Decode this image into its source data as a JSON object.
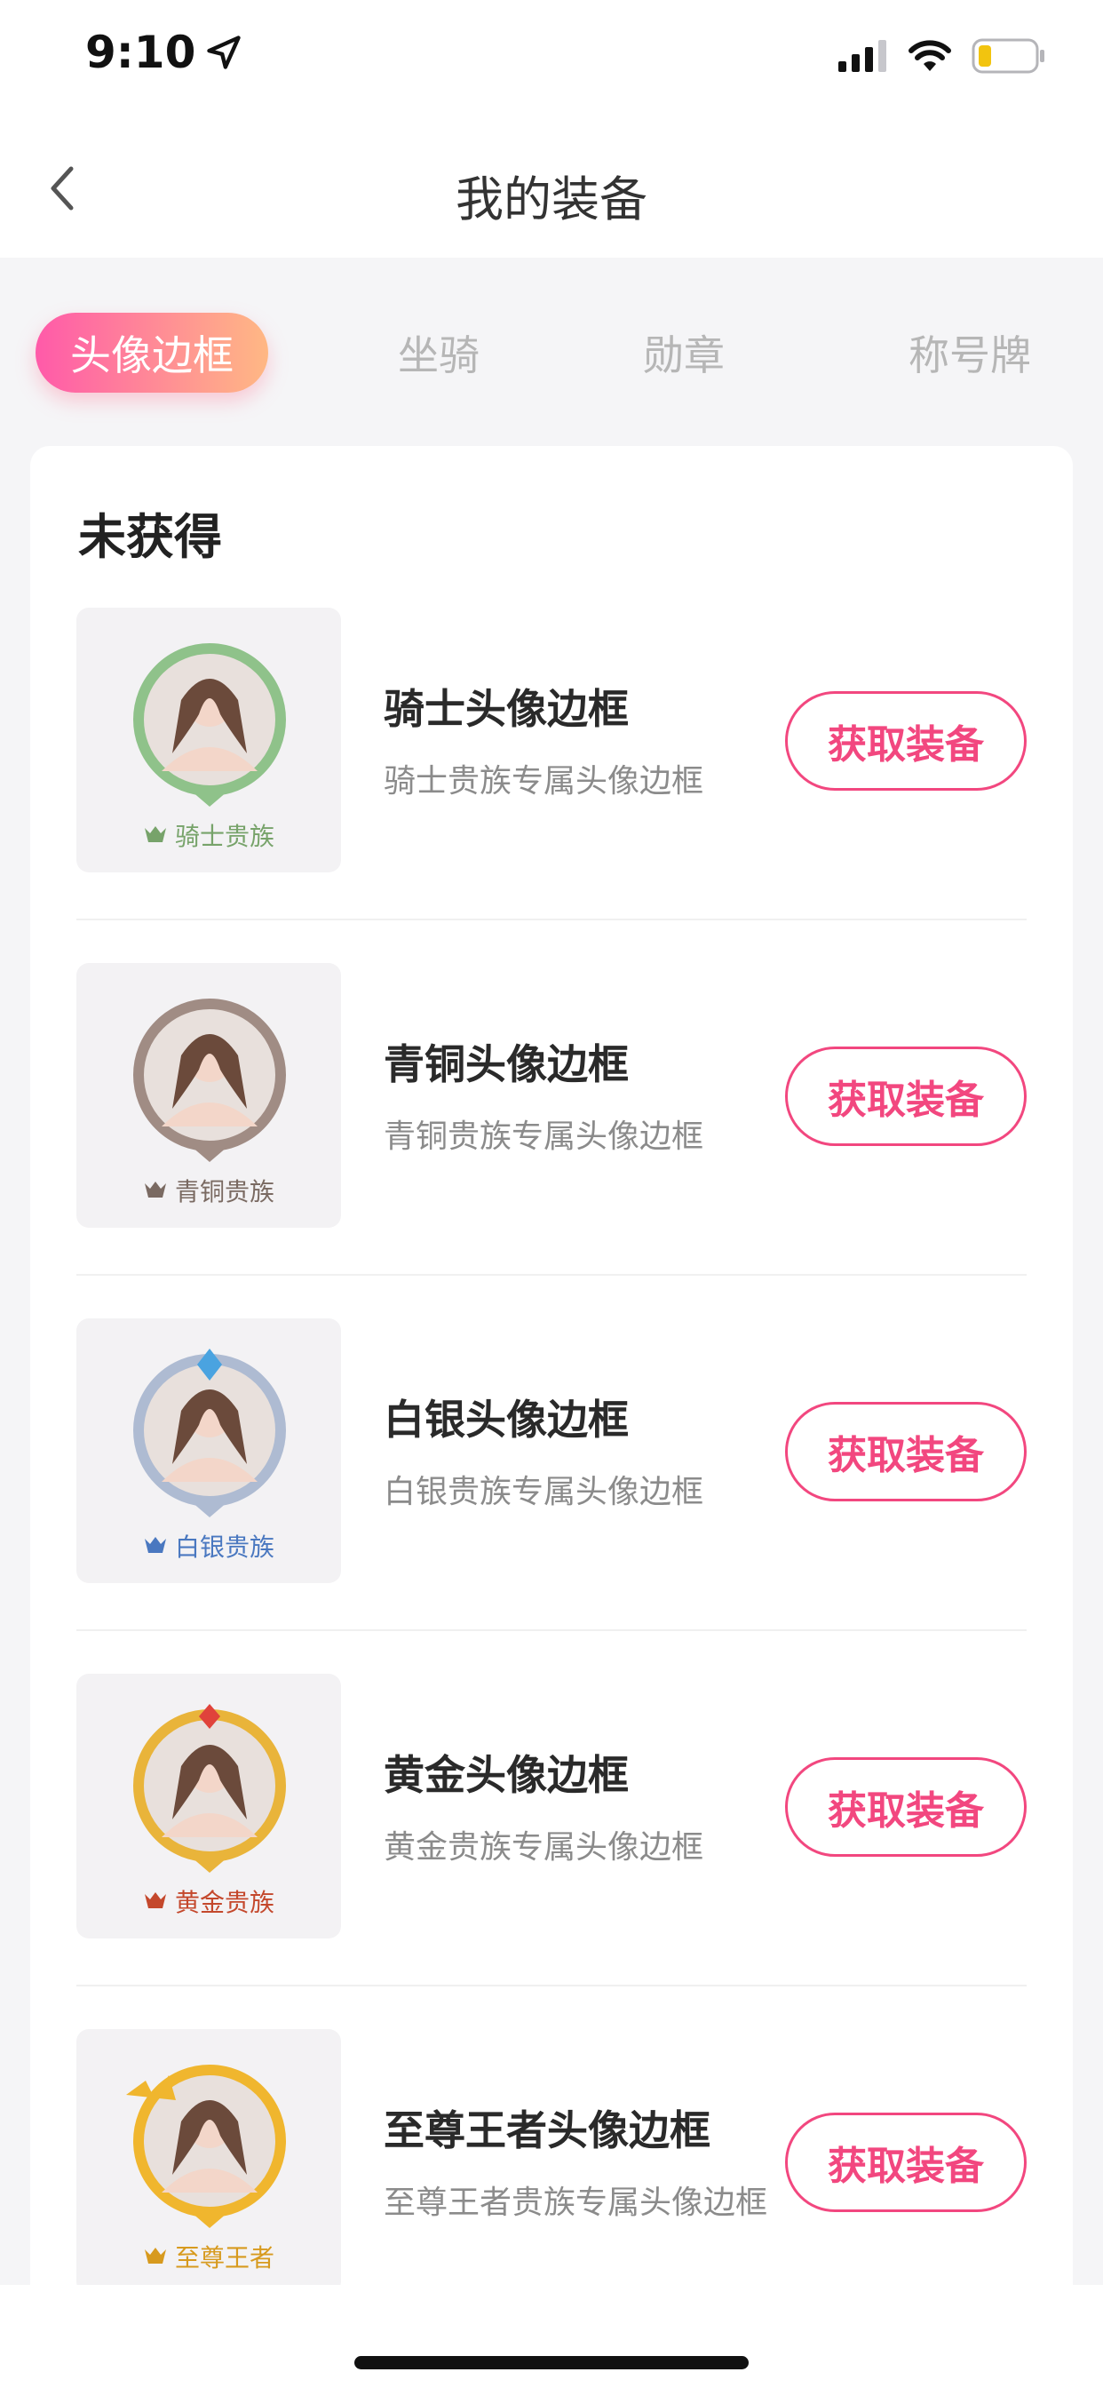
{
  "status_bar": {
    "time": "9:10",
    "icons": [
      "location-arrow-icon",
      "cellular-signal-icon",
      "wifi-icon",
      "battery-low-icon"
    ],
    "battery_color": "#f2c40f"
  },
  "nav": {
    "title": "我的装备",
    "back_icon": "chevron-left-icon"
  },
  "tabs": [
    {
      "label": "头像边框",
      "active": true
    },
    {
      "label": "坐骑",
      "active": false
    },
    {
      "label": "勋章",
      "active": false
    },
    {
      "label": "称号牌",
      "active": false
    }
  ],
  "section": {
    "title": "未获得"
  },
  "items": [
    {
      "name": "骑士头像边框",
      "desc": "骑士贵族专属头像边框",
      "tier": "骑士贵族",
      "tier_color": "#77a36a",
      "frame_color": "#8fc28a",
      "button": "获取装备"
    },
    {
      "name": "青铜头像边框",
      "desc": "青铜贵族专属头像边框",
      "tier": "青铜贵族",
      "tier_color": "#7a6a62",
      "frame_color": "#a08c84",
      "button": "获取装备"
    },
    {
      "name": "白银头像边框",
      "desc": "白银贵族专属头像边框",
      "tier": "白银贵族",
      "tier_color": "#4a78c0",
      "frame_color": "#aebbd2",
      "button": "获取装备"
    },
    {
      "name": "黄金头像边框",
      "desc": "黄金贵族专属头像边框",
      "tier": "黄金贵族",
      "tier_color": "#c4482c",
      "frame_color": "#e9b43a",
      "button": "获取装备"
    },
    {
      "name": "至尊王者头像边框",
      "desc": "至尊王者贵族专属头像边框",
      "tier": "至尊王者",
      "tier_color": "#d79a1e",
      "frame_color": "#f0b62e",
      "button": "获取装备"
    }
  ],
  "colors": {
    "accent": "#f2477f",
    "tab_gradient_start": "#ff5aa9",
    "tab_gradient_end": "#ffb884"
  }
}
